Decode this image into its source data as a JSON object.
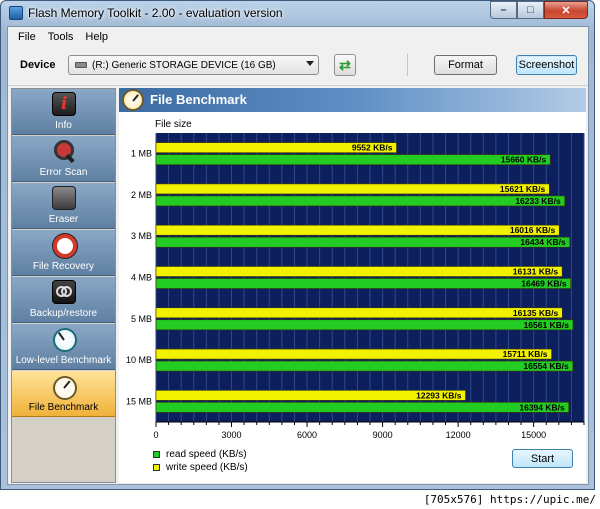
{
  "window": {
    "title": "Flash Memory Toolkit - 2.00 - evaluation version",
    "controls": {
      "minimize": "–",
      "maximize": "□",
      "close": "✕"
    }
  },
  "menu": {
    "items": [
      "File",
      "Tools",
      "Help"
    ]
  },
  "toolbar": {
    "device_label": "Device",
    "device_value": "(R:) Generic STORAGE DEVICE (16 GB)",
    "format_label": "Format",
    "screenshot_label": "Screenshot",
    "refresh_icon": "refresh-icon"
  },
  "sidebar": {
    "items": [
      {
        "label": "Info",
        "icon": "info-icon"
      },
      {
        "label": "Error Scan",
        "icon": "magnifier-icon"
      },
      {
        "label": "Eraser",
        "icon": "trash-icon"
      },
      {
        "label": "File Recovery",
        "icon": "lifebuoy-icon"
      },
      {
        "label": "Backup/restore",
        "icon": "tape-icon"
      },
      {
        "label": "Low-level Benchmark",
        "icon": "clock-icon"
      },
      {
        "label": "File Benchmark",
        "icon": "stopwatch-icon"
      }
    ],
    "active_index": 6
  },
  "panel": {
    "title": "File Benchmark",
    "start_label": "Start"
  },
  "chart_data": {
    "type": "bar",
    "orientation": "horizontal",
    "ylabel": "File size",
    "categories": [
      "1 MB",
      "2 MB",
      "3 MB",
      "4 MB",
      "5 MB",
      "10 MB",
      "15 MB"
    ],
    "series": [
      {
        "name": "write speed (KB/s)",
        "color": "#f2f200",
        "values": [
          9552,
          15621,
          16016,
          16131,
          16135,
          15711,
          12293
        ],
        "labels": [
          "9552 KB/s",
          "15621 KB/s",
          "16016 KB/s",
          "16131 KB/s",
          "16135 KB/s",
          "15711 KB/s",
          "12293 KB/s"
        ]
      },
      {
        "name": "read speed (KB/s)",
        "color": "#22cc22",
        "values": [
          15660,
          16233,
          16434,
          16469,
          16561,
          16554,
          16394
        ],
        "labels": [
          "15660 KB/s",
          "16233 KB/s",
          "16434 KB/s",
          "16469 KB/s",
          "16561 KB/s",
          "16554 KB/s",
          "16394 KB/s"
        ]
      }
    ],
    "xlim": [
      0,
      17000
    ],
    "xticks": [
      0,
      3000,
      6000,
      9000,
      12000,
      15000
    ],
    "plot_background": "#0d1f5c",
    "legend": [
      "read speed (KB/s)",
      "write speed (KB/s)"
    ],
    "legend_colors": [
      "#22cc22",
      "#f2f200"
    ]
  },
  "footer": {
    "text": "[705x576] https://upic.me/"
  }
}
